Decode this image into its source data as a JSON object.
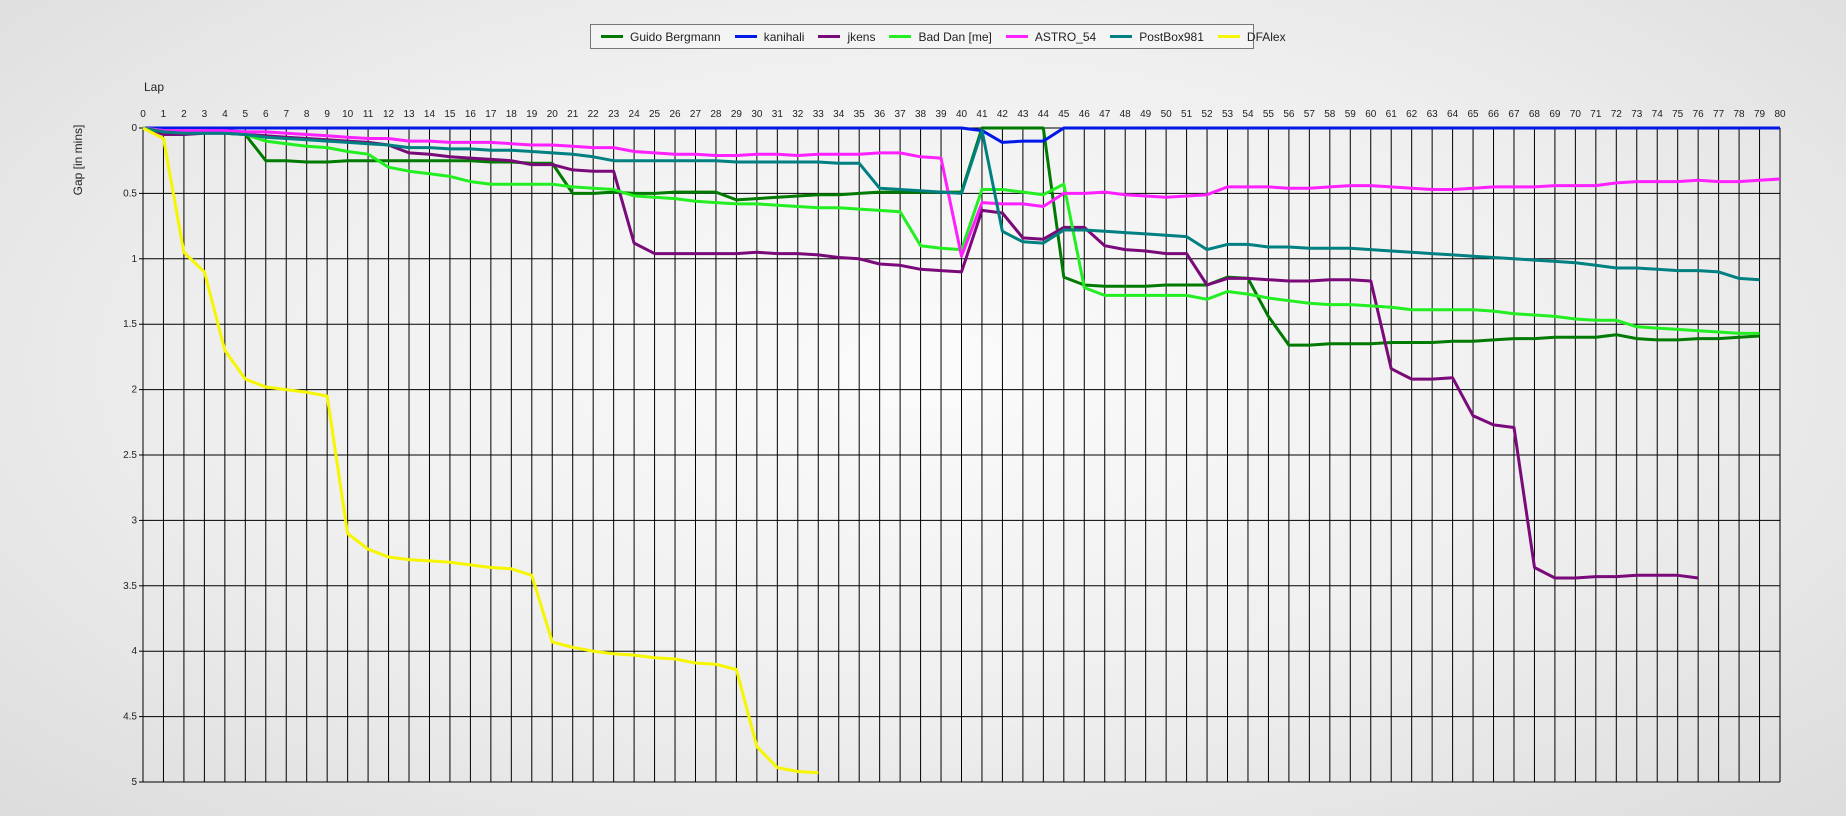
{
  "chart_data": {
    "type": "line",
    "xlabel": "Lap",
    "ylabel": "Gap [in mins]",
    "xlim": [
      0,
      80
    ],
    "ylim": [
      0,
      5
    ],
    "y_inverted": true,
    "grid": true,
    "legend_position": "top-center",
    "x_ticks": [
      "0",
      "1",
      "2",
      "3",
      "4",
      "5",
      "6",
      "7",
      "8",
      "9",
      "10",
      "11",
      "12",
      "13",
      "14",
      "15",
      "16",
      "17",
      "18",
      "19",
      "20",
      "21",
      "22",
      "23",
      "24",
      "25",
      "26",
      "27",
      "28",
      "29",
      "30",
      "31",
      "32",
      "33",
      "34",
      "35",
      "36",
      "37",
      "38",
      "39",
      "40",
      "41",
      "42",
      "43",
      "44",
      "45",
      "46",
      "47",
      "48",
      "49",
      "50",
      "51",
      "52",
      "53",
      "54",
      "55",
      "56",
      "57",
      "58",
      "59",
      "60",
      "61",
      "62",
      "63",
      "64",
      "65",
      "66",
      "67",
      "68",
      "69",
      "70",
      "71",
      "72",
      "73",
      "74",
      "75",
      "76",
      "77",
      "78",
      "79",
      "80"
    ],
    "y_ticks": [
      "0",
      "0.5",
      "1",
      "1.5",
      "2",
      "2.5",
      "3",
      "3.5",
      "4",
      "4.5",
      "5"
    ],
    "series": [
      {
        "name": "Guido Bergmann",
        "color": "#007a00",
        "values": [
          0,
          0.01,
          0.01,
          0.01,
          0.01,
          0.05,
          0.25,
          0.25,
          0.26,
          0.26,
          0.25,
          0.25,
          0.25,
          0.25,
          0.25,
          0.25,
          0.25,
          0.26,
          0.26,
          0.27,
          0.27,
          0.5,
          0.5,
          0.49,
          0.5,
          0.5,
          0.49,
          0.49,
          0.49,
          0.55,
          0.54,
          0.53,
          0.52,
          0.51,
          0.51,
          0.5,
          0.49,
          0.49,
          0.49,
          0.49,
          0.49,
          0,
          0,
          0,
          0,
          1.14,
          1.2,
          1.21,
          1.21,
          1.21,
          1.2,
          1.2,
          1.2,
          1.14,
          1.15,
          1.44,
          1.66,
          1.66,
          1.65,
          1.65,
          1.65,
          1.64,
          1.64,
          1.64,
          1.63,
          1.63,
          1.62,
          1.61,
          1.61,
          1.6,
          1.6,
          1.6,
          1.58,
          1.61,
          1.62,
          1.62,
          1.61,
          1.61,
          1.6,
          1.59
        ]
      },
      {
        "name": "kanihali",
        "color": "#0018e8",
        "values": [
          0,
          0,
          0,
          0,
          0,
          0,
          0,
          0,
          0,
          0,
          0,
          0,
          0,
          0,
          0,
          0,
          0,
          0,
          0,
          0,
          0,
          0,
          0,
          0,
          0,
          0,
          0,
          0,
          0,
          0,
          0,
          0,
          0,
          0,
          0,
          0,
          0,
          0,
          0,
          0,
          0,
          0.02,
          0.11,
          0.1,
          0.1,
          0,
          0,
          0,
          0,
          0,
          0,
          0,
          0,
          0,
          0,
          0,
          0,
          0,
          0,
          0,
          0,
          0,
          0,
          0,
          0,
          0,
          0,
          0,
          0,
          0,
          0,
          0,
          0,
          0,
          0,
          0,
          0,
          0,
          0,
          0,
          0
        ]
      },
      {
        "name": "jkens",
        "color": "#7a0a7a",
        "values": [
          0,
          0.05,
          0.05,
          0.04,
          0.04,
          0.05,
          0.06,
          0.07,
          0.08,
          0.09,
          0.1,
          0.11,
          0.13,
          0.19,
          0.2,
          0.22,
          0.23,
          0.24,
          0.25,
          0.28,
          0.28,
          0.32,
          0.33,
          0.33,
          0.88,
          0.96,
          0.96,
          0.96,
          0.96,
          0.96,
          0.95,
          0.96,
          0.96,
          0.97,
          0.99,
          1.0,
          1.04,
          1.05,
          1.08,
          1.09,
          1.1,
          0.63,
          0.65,
          0.84,
          0.85,
          0.76,
          0.76,
          0.9,
          0.93,
          0.94,
          0.96,
          0.96,
          1.2,
          1.15,
          1.15,
          1.16,
          1.17,
          1.17,
          1.16,
          1.16,
          1.17,
          1.84,
          1.92,
          1.92,
          1.91,
          2.2,
          2.27,
          2.29,
          3.36,
          3.44,
          3.44,
          3.43,
          3.43,
          3.42,
          3.42,
          3.42,
          3.44
        ]
      },
      {
        "name": "Bad Dan [me]",
        "color": "#22ee22",
        "values": [
          0,
          0.02,
          0.02,
          0.02,
          0.03,
          0.05,
          0.1,
          0.12,
          0.14,
          0.15,
          0.18,
          0.2,
          0.3,
          0.33,
          0.35,
          0.37,
          0.41,
          0.43,
          0.43,
          0.43,
          0.43,
          0.45,
          0.46,
          0.47,
          0.52,
          0.53,
          0.54,
          0.56,
          0.57,
          0.58,
          0.58,
          0.59,
          0.6,
          0.61,
          0.61,
          0.62,
          0.63,
          0.64,
          0.9,
          0.92,
          0.93,
          0.47,
          0.47,
          0.49,
          0.51,
          0.43,
          1.22,
          1.28,
          1.28,
          1.28,
          1.28,
          1.28,
          1.31,
          1.25,
          1.27,
          1.3,
          1.32,
          1.34,
          1.35,
          1.35,
          1.36,
          1.37,
          1.39,
          1.39,
          1.39,
          1.39,
          1.4,
          1.42,
          1.43,
          1.44,
          1.46,
          1.47,
          1.47,
          1.52,
          1.53,
          1.54,
          1.55,
          1.56,
          1.57,
          1.57
        ]
      },
      {
        "name": "ASTRO_54",
        "color": "#ff20ff",
        "values": [
          0,
          0.02,
          0.02,
          0.02,
          0.02,
          0.03,
          0.03,
          0.04,
          0.05,
          0.06,
          0.07,
          0.08,
          0.08,
          0.1,
          0.1,
          0.11,
          0.11,
          0.11,
          0.12,
          0.13,
          0.13,
          0.14,
          0.15,
          0.15,
          0.18,
          0.19,
          0.2,
          0.2,
          0.21,
          0.21,
          0.2,
          0.2,
          0.21,
          0.2,
          0.2,
          0.2,
          0.19,
          0.19,
          0.22,
          0.23,
          0.98,
          0.57,
          0.58,
          0.58,
          0.6,
          0.5,
          0.5,
          0.49,
          0.51,
          0.52,
          0.53,
          0.52,
          0.51,
          0.45,
          0.45,
          0.45,
          0.46,
          0.46,
          0.45,
          0.44,
          0.44,
          0.45,
          0.46,
          0.47,
          0.47,
          0.46,
          0.45,
          0.45,
          0.45,
          0.44,
          0.44,
          0.44,
          0.42,
          0.41,
          0.41,
          0.41,
          0.4,
          0.41,
          0.41,
          0.4,
          0.39
        ]
      },
      {
        "name": "PostBox981",
        "color": "#008080",
        "values": [
          0,
          0.03,
          0.04,
          0.04,
          0.04,
          0.05,
          0.07,
          0.08,
          0.09,
          0.1,
          0.11,
          0.12,
          0.13,
          0.15,
          0.15,
          0.16,
          0.16,
          0.17,
          0.17,
          0.18,
          0.19,
          0.2,
          0.22,
          0.25,
          0.25,
          0.25,
          0.25,
          0.25,
          0.25,
          0.26,
          0.26,
          0.26,
          0.26,
          0.26,
          0.27,
          0.27,
          0.46,
          0.47,
          0.48,
          0.49,
          0.5,
          0.02,
          0.79,
          0.87,
          0.88,
          0.78,
          0.78,
          0.79,
          0.8,
          0.81,
          0.82,
          0.83,
          0.93,
          0.89,
          0.89,
          0.91,
          0.91,
          0.92,
          0.92,
          0.92,
          0.93,
          0.94,
          0.95,
          0.96,
          0.97,
          0.98,
          0.99,
          1.0,
          1.01,
          1.02,
          1.03,
          1.05,
          1.07,
          1.07,
          1.08,
          1.09,
          1.09,
          1.1,
          1.15,
          1.16
        ]
      },
      {
        "name": "DFAlex",
        "color": "#f6f600",
        "values": [
          0,
          0.08,
          0.95,
          1.1,
          1.7,
          1.92,
          1.98,
          2.0,
          2.02,
          2.05,
          3.1,
          3.22,
          3.28,
          3.3,
          3.31,
          3.32,
          3.34,
          3.36,
          3.37,
          3.42,
          3.93,
          3.97,
          4.0,
          4.02,
          4.03,
          4.05,
          4.06,
          4.09,
          4.1,
          4.14,
          4.73,
          4.89,
          4.92,
          4.93
        ]
      }
    ]
  }
}
